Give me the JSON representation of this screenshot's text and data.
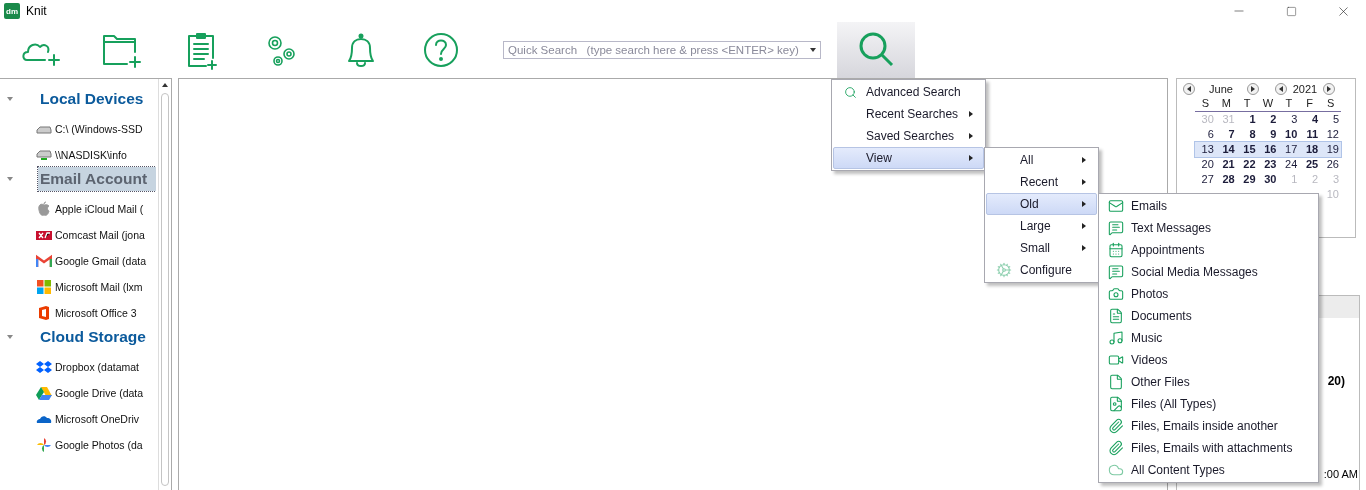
{
  "window": {
    "logo": "dm",
    "title": "Knit"
  },
  "search": {
    "placeholder": "Quick Search   (type search here & press <ENTER> key)",
    "pressed": true
  },
  "tree": [
    {
      "label": "Local Devices",
      "expanded": true,
      "selected": false,
      "children": [
        {
          "label": "C:\\ (Windows-SSD",
          "kind": "drive"
        },
        {
          "label": "\\\\NASDISK\\info",
          "kind": "network"
        }
      ]
    },
    {
      "label": "Email Account",
      "expanded": true,
      "selected": true,
      "children": [
        {
          "label": "Apple iCloud Mail (",
          "kind": "apple"
        },
        {
          "label": "Comcast Mail (jona",
          "kind": "comcast"
        },
        {
          "label": "Google Gmail (data",
          "kind": "gmail"
        },
        {
          "label": "Microsoft Mail (lxm",
          "kind": "windows"
        },
        {
          "label": "Microsoft Office 3",
          "kind": "office"
        }
      ]
    },
    {
      "label": "Cloud Storage",
      "expanded": true,
      "selected": false,
      "children": [
        {
          "label": "Dropbox (datamat",
          "kind": "dropbox"
        },
        {
          "label": "Google Drive (data",
          "kind": "gdrive"
        },
        {
          "label": "Microsoft OneDriv",
          "kind": "onedrive"
        },
        {
          "label": "Google Photos (da",
          "kind": "photos"
        }
      ]
    }
  ],
  "calendar": {
    "month": "June",
    "year": "2021",
    "weekdays": [
      "S",
      "M",
      "T",
      "W",
      "T",
      "F",
      "S"
    ],
    "weeks": [
      {
        "selected": false,
        "days": [
          {
            "day": "30",
            "kind": "other"
          },
          {
            "day": "31",
            "kind": "other"
          },
          {
            "day": "1",
            "kind": "bold"
          },
          {
            "day": "2",
            "kind": "bold"
          },
          {
            "day": "3",
            "kind": "plain"
          },
          {
            "day": "4",
            "kind": "bold"
          },
          {
            "day": "5",
            "kind": "plain"
          }
        ]
      },
      {
        "selected": false,
        "days": [
          {
            "day": "6",
            "kind": "plain"
          },
          {
            "day": "7",
            "kind": "bold"
          },
          {
            "day": "8",
            "kind": "bold"
          },
          {
            "day": "9",
            "kind": "bold"
          },
          {
            "day": "10",
            "kind": "bold"
          },
          {
            "day": "11",
            "kind": "bold"
          },
          {
            "day": "12",
            "kind": "plain"
          }
        ]
      },
      {
        "selected": true,
        "days": [
          {
            "day": "13",
            "kind": "plain"
          },
          {
            "day": "14",
            "kind": "bold"
          },
          {
            "day": "15",
            "kind": "bold"
          },
          {
            "day": "16",
            "kind": "bold"
          },
          {
            "day": "17",
            "kind": "plain"
          },
          {
            "day": "18",
            "kind": "bold"
          },
          {
            "day": "19",
            "kind": "plain"
          }
        ]
      },
      {
        "selected": false,
        "days": [
          {
            "day": "20",
            "kind": "plain"
          },
          {
            "day": "21",
            "kind": "bold"
          },
          {
            "day": "22",
            "kind": "bold"
          },
          {
            "day": "23",
            "kind": "bold"
          },
          {
            "day": "24",
            "kind": "plain"
          },
          {
            "day": "25",
            "kind": "bold"
          },
          {
            "day": "26",
            "kind": "plain"
          }
        ]
      },
      {
        "selected": false,
        "days": [
          {
            "day": "27",
            "kind": "plain"
          },
          {
            "day": "28",
            "kind": "bold"
          },
          {
            "day": "29",
            "kind": "bold"
          },
          {
            "day": "30",
            "kind": "bold"
          },
          {
            "day": "1",
            "kind": "other"
          },
          {
            "day": "2",
            "kind": "other"
          },
          {
            "day": "3",
            "kind": "other"
          }
        ]
      },
      {
        "selected": false,
        "days": [
          {
            "day": "10",
            "kind": "other"
          }
        ]
      }
    ]
  },
  "details": {
    "line_1": "20)",
    "line_2": ":00 AM"
  },
  "search_menu": [
    {
      "label": "Advanced Search",
      "kind": "search",
      "submenu": false,
      "selected": false
    },
    {
      "label": "Recent Searches",
      "kind": "plain",
      "submenu": true,
      "selected": false
    },
    {
      "label": "Saved Searches",
      "kind": "plain",
      "submenu": true,
      "selected": false
    },
    {
      "label": "View",
      "kind": "plain",
      "submenu": true,
      "selected": true
    }
  ],
  "view_menu": [
    {
      "label": "All",
      "kind": "plain",
      "submenu": true,
      "selected": false
    },
    {
      "label": "Recent",
      "kind": "plain",
      "submenu": true,
      "selected": false
    },
    {
      "label": "Old",
      "kind": "plain",
      "submenu": true,
      "selected": true
    },
    {
      "label": "Large",
      "kind": "plain",
      "submenu": true,
      "selected": false
    },
    {
      "label": "Small",
      "kind": "plain",
      "submenu": true,
      "selected": false
    },
    {
      "label": "Configure",
      "kind": "gears",
      "submenu": false,
      "selected": false
    }
  ],
  "old_menu": [
    {
      "label": "Emails",
      "kind": "mail"
    },
    {
      "label": "Text Messages",
      "kind": "message"
    },
    {
      "label": "Appointments",
      "kind": "calendar"
    },
    {
      "label": "Social Media Messages",
      "kind": "message"
    },
    {
      "label": "Photos",
      "kind": "camera"
    },
    {
      "label": "Documents",
      "kind": "document"
    },
    {
      "label": "Music",
      "kind": "music"
    },
    {
      "label": "Videos",
      "kind": "video"
    },
    {
      "label": "Other Files",
      "kind": "file"
    },
    {
      "label": "Files (All Types)",
      "kind": "image"
    },
    {
      "label": "Files, Emails inside another",
      "kind": "paperclip"
    },
    {
      "label": "Files, Emails with attachments",
      "kind": "attachments"
    },
    {
      "label": "All Content Types",
      "kind": "cloud"
    }
  ]
}
